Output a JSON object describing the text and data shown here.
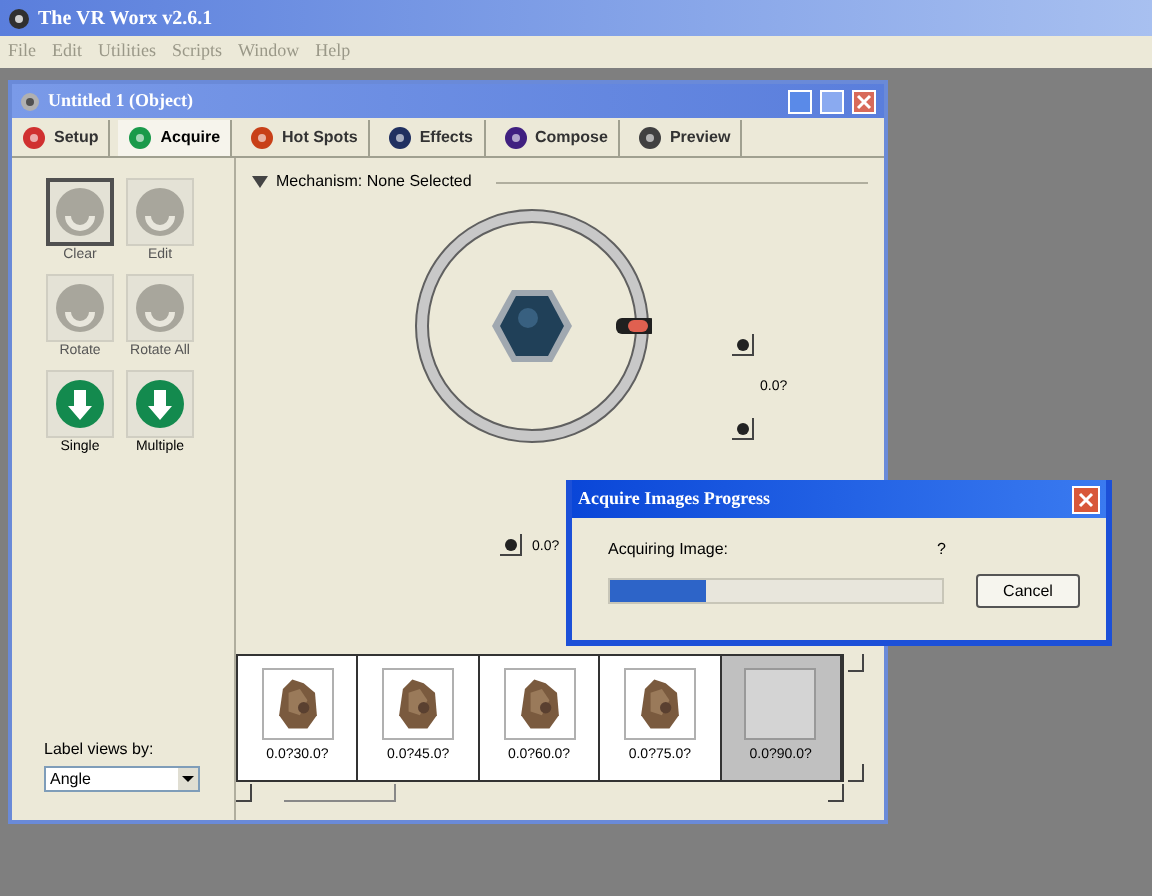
{
  "app": {
    "title": "The VR Worx v2.6.1",
    "menu": [
      "File",
      "Edit",
      "Utilities",
      "Scripts",
      "Window",
      "Help"
    ]
  },
  "window": {
    "title": "Untitled 1 (Object)"
  },
  "tabs": [
    {
      "label": "Setup",
      "selected": false,
      "color": "#d03030"
    },
    {
      "label": "Acquire",
      "selected": true,
      "color": "#1a9a4a"
    },
    {
      "label": "Hot Spots",
      "selected": false,
      "color": "#c84018"
    },
    {
      "label": "Effects",
      "selected": false,
      "color": "#203060"
    },
    {
      "label": "Compose",
      "selected": false,
      "color": "#402080"
    },
    {
      "label": "Preview",
      "selected": false,
      "color": "#404040"
    }
  ],
  "tools": [
    {
      "label": "Clear",
      "disabled": true,
      "selected": true
    },
    {
      "label": "Edit",
      "disabled": true,
      "selected": false
    },
    {
      "label": "Rotate",
      "disabled": true,
      "selected": false
    },
    {
      "label": "Rotate All",
      "disabled": true,
      "selected": false
    },
    {
      "label": "Single",
      "disabled": false,
      "selected": false
    },
    {
      "label": "Multiple",
      "disabled": false,
      "selected": false
    }
  ],
  "mechanism": {
    "header": "Mechanism: None Selected",
    "pan_reading": "0.0?",
    "tilt_reading": "0.0?"
  },
  "label_views": {
    "label": "Label views by:",
    "value": "Angle"
  },
  "thumbnails": [
    {
      "label": "0.0?30.0?",
      "kind": "picture",
      "selected": false
    },
    {
      "label": "0.0?45.0?",
      "kind": "picture",
      "selected": false
    },
    {
      "label": "0.0?60.0?",
      "kind": "picture",
      "selected": false
    },
    {
      "label": "0.0?75.0?",
      "kind": "picture",
      "selected": false
    },
    {
      "label": "0.0?90.0?",
      "kind": "empty",
      "selected": true
    }
  ],
  "dialog": {
    "title": "Acquire Images Progress",
    "status": "Acquiring Image:",
    "count": "?",
    "level": 0.29,
    "button": "Cancel"
  }
}
